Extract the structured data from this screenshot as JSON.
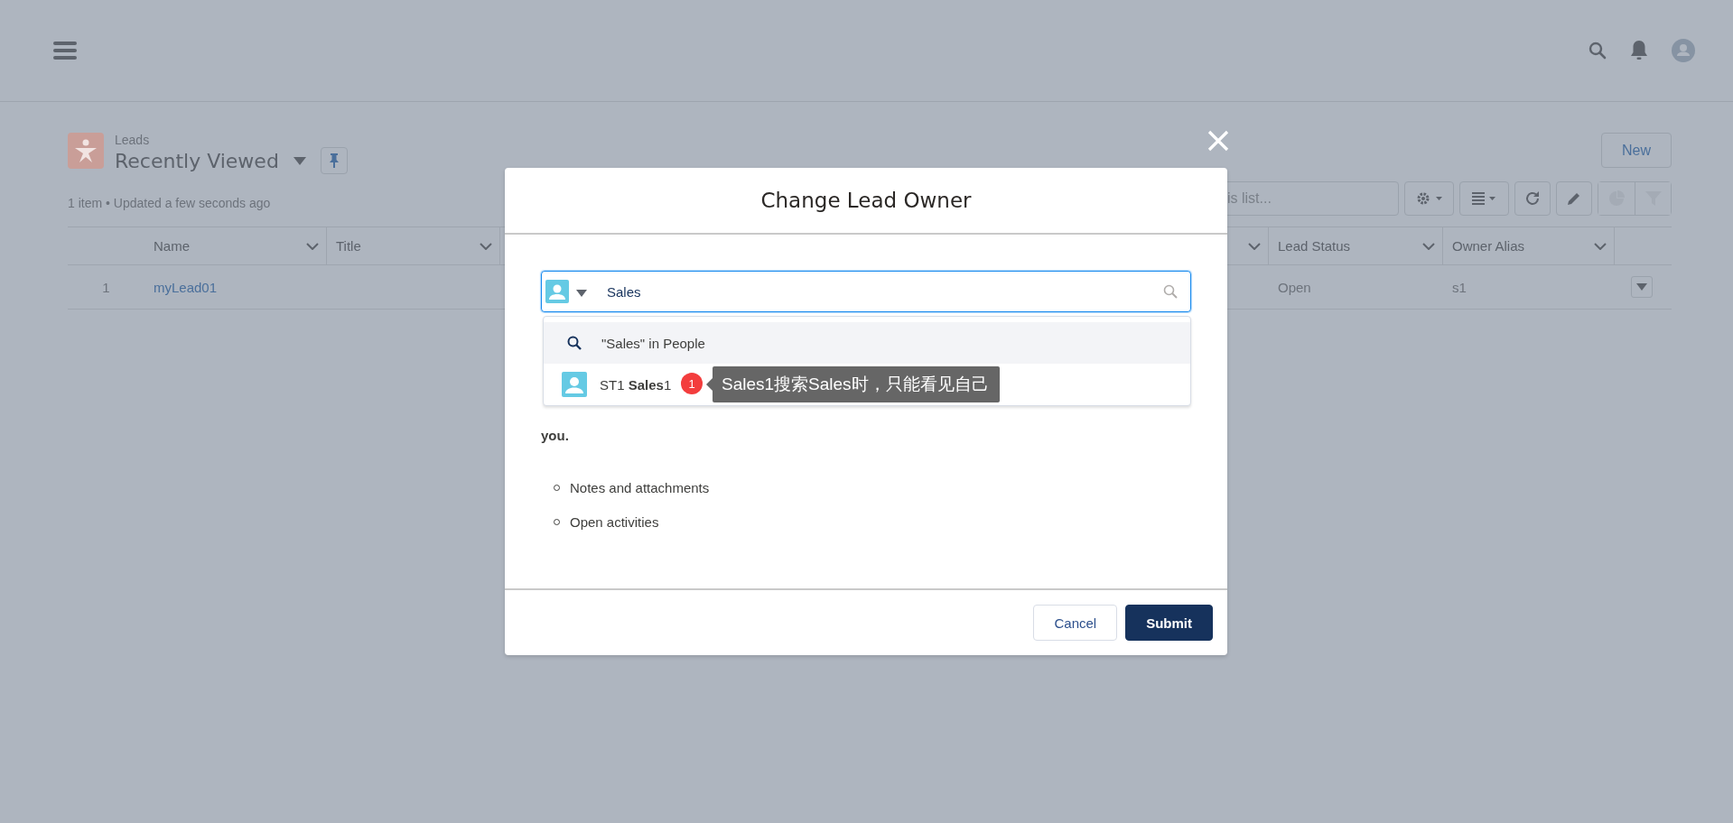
{
  "list_view": {
    "object_label": "Leads",
    "title": "Recently Viewed",
    "status": "1 item • Updated a few seconds ago",
    "new_button": "New",
    "search": {
      "placeholder": "is list..."
    }
  },
  "table": {
    "columns": [
      "Name",
      "Title",
      "Lead Status",
      "Owner Alias"
    ],
    "rows": [
      {
        "number": "1",
        "name": "myLead01",
        "lead_status": "Open",
        "owner_alias": "s1"
      }
    ]
  },
  "modal": {
    "title": "Change Lead Owner",
    "search": {
      "value": "Sales"
    },
    "suggestions": [
      {
        "kind": "search",
        "text": "\"Sales\" in People",
        "selected": true
      },
      {
        "kind": "user",
        "text": "ST1 **Sales**1",
        "selected": false
      }
    ],
    "body_tail": "you.",
    "bullets": [
      "Notes and attachments",
      "Open activities"
    ],
    "buttons": [
      {
        "label": "Cancel",
        "kind": "neutral"
      },
      {
        "label": "Submit",
        "kind": "brand"
      }
    ]
  },
  "annotation": {
    "badge": "1",
    "text": "Sales1搜索Sales时，只能看见自己"
  }
}
